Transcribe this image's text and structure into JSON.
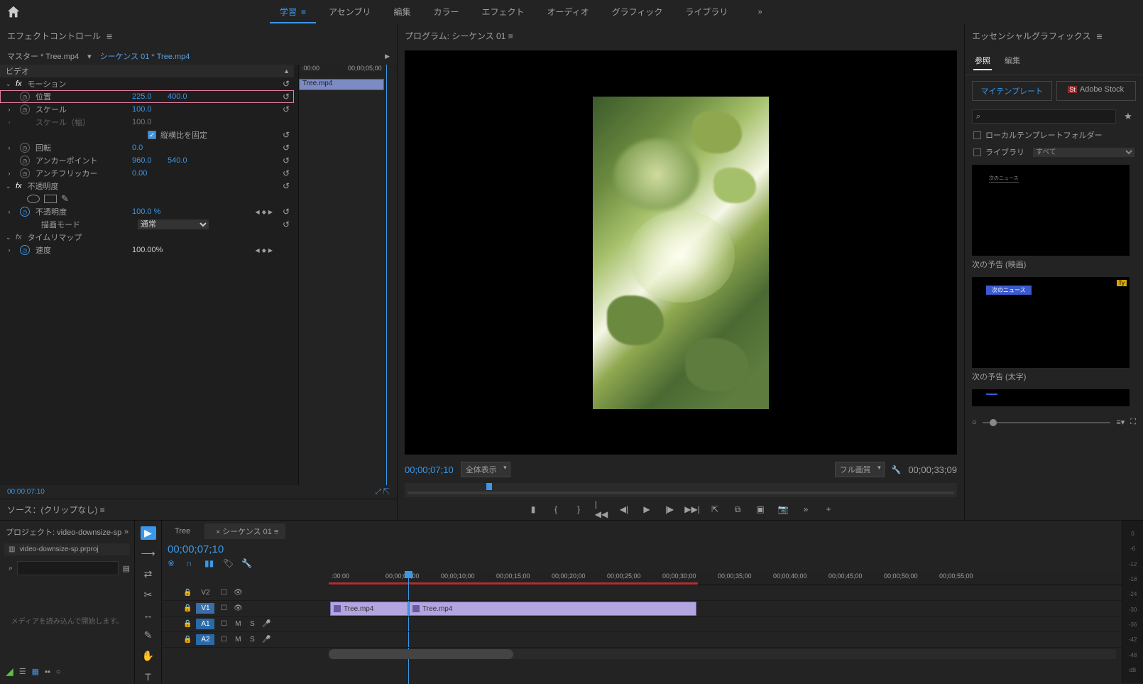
{
  "menubar": {
    "tabs": [
      "学習",
      "アセンブリ",
      "編集",
      "カラー",
      "エフェクト",
      "オーディオ",
      "グラフィック",
      "ライブラリ"
    ],
    "active_index": 0
  },
  "effect_controls": {
    "title": "エフェクトコントロール",
    "master": "マスター * Tree.mp4",
    "sequence": "シーケンス 01 * Tree.mp4",
    "video_label": "ビデオ",
    "motion": {
      "label": "モーション",
      "position": {
        "label": "位置",
        "x": "225.0",
        "y": "400.0"
      },
      "scale": {
        "label": "スケール",
        "value": "100.0"
      },
      "scale_w": {
        "label": "スケール（幅）",
        "value": "100.0"
      },
      "uniform": {
        "label": "縦横比を固定",
        "checked": true
      },
      "rotation": {
        "label": "回転",
        "value": "0.0"
      },
      "anchor": {
        "label": "アンカーポイント",
        "x": "960.0",
        "y": "540.0"
      },
      "antiflicker": {
        "label": "アンチフリッカー",
        "value": "0.00"
      }
    },
    "opacity": {
      "label": "不透明度",
      "value_label": "不透明度",
      "value": "100.0 %",
      "blend_label": "描画モード",
      "blend_value": "通常"
    },
    "timeremap": {
      "label": "タイムリマップ",
      "speed_label": "速度",
      "speed_value": "100.00%"
    },
    "mini_ruler": {
      "t0": ":00:00",
      "t1": "00;00;05;00"
    },
    "mini_clip": "Tree.mp4",
    "footer_tc": "00:00:07:10"
  },
  "program": {
    "title": "プログラム: シーケンス 01",
    "tc": "00;00;07;10",
    "fit": "全体表示",
    "quality": "フル画質",
    "duration": "00;00;33;09"
  },
  "essential_graphics": {
    "title": "エッセンシャルグラフィックス",
    "tabs": [
      "参照",
      "編集"
    ],
    "my_templates": "マイテンプレート",
    "adobe_stock": "Adobe Stock",
    "local_folder": "ローカルテンプレートフォルダー",
    "library": "ライブラリ",
    "library_filter": "すべて",
    "template1_inner": "次のニュース",
    "template1_caption": "次の予告 (映画)",
    "template2_inner": "次のニュース",
    "template2_caption": "次の予告 (太字)"
  },
  "source_panel_title": "ソース：(クリップなし)",
  "project": {
    "header": "プロジェクト: video-downsize-sp",
    "filename": "video-downsize-sp.prproj",
    "empty_msg": "メディアを読み込んで開始します。"
  },
  "timeline": {
    "tabs": [
      {
        "label": "Tree",
        "active": false
      },
      {
        "label": "シーケンス 01",
        "active": true
      }
    ],
    "tc": "00;00;07;10",
    "ruler_ticks": [
      ":00:00",
      "00;00;05;00",
      "00;00;10;00",
      "00;00;15;00",
      "00;00;20;00",
      "00;00;25;00",
      "00;00;30;00",
      "00;00;35;00",
      "00;00;40;00",
      "00;00;45;00",
      "00;00;50;00",
      "00;00;55;00"
    ],
    "tracks": {
      "v2": "V2",
      "v1": "V1",
      "a1": "A1",
      "a2": "A2"
    },
    "clip1": "Tree.mp4",
    "clip2": "Tree.mp4"
  },
  "audiometer": [
    "0",
    "-6",
    "-12",
    "-18",
    "-24",
    "-30",
    "-36",
    "-42",
    "-48",
    "dB"
  ]
}
